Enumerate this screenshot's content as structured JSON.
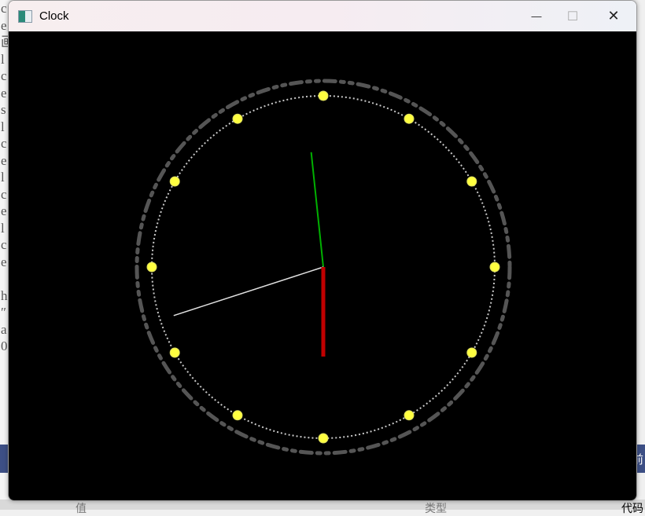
{
  "window": {
    "title": "Clock",
    "controls": {
      "minimize": "—",
      "maximize": "☐",
      "close": "✕"
    }
  },
  "background": {
    "left_chars": [
      "c",
      "e",
      "画",
      "l",
      "c",
      "e",
      "s",
      "l",
      "c",
      "e",
      "l",
      "c",
      "e",
      "l",
      "c",
      "e",
      "",
      "h",
      "″",
      "a",
      "0"
    ],
    "bottom_labels": [
      "值",
      "类型",
      "代码"
    ],
    "bar_right_char": "前"
  },
  "clock": {
    "hands": {
      "hour_deg": 180,
      "minute_deg": 354,
      "second_deg": 252
    },
    "colors": {
      "background": "#000000",
      "hour_hand": "#c00000",
      "minute_hand": "#00b000",
      "second_hand": "#e0e0e0",
      "hour_markers": "#ffff40",
      "inner_ring": "#c8c8c8",
      "outer_ring": "#555555"
    },
    "hour_marker_count": 12
  }
}
